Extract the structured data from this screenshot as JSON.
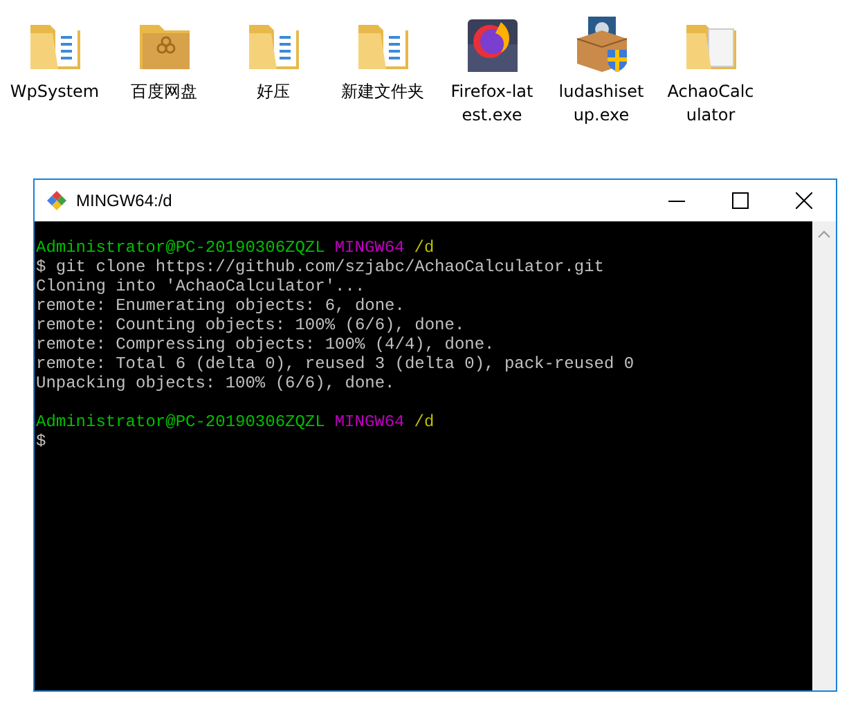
{
  "desktop_icons": [
    {
      "kind": "folder",
      "label": [
        "WpSystem"
      ],
      "selected": false
    },
    {
      "kind": "baidu-folder",
      "label": [
        "百度网盘"
      ],
      "selected": false
    },
    {
      "kind": "folder",
      "label": [
        "好压"
      ],
      "selected": false
    },
    {
      "kind": "folder",
      "label": [
        "新建文件夹"
      ],
      "selected": false
    },
    {
      "kind": "firefox",
      "label": [
        "Firefox-lat",
        "est.exe"
      ],
      "selected": false
    },
    {
      "kind": "installer",
      "label": [
        "ludashiset",
        "up.exe"
      ],
      "selected": false
    },
    {
      "kind": "empty-folder",
      "label": [
        "AchaoCalc",
        "ulator"
      ],
      "selected": false
    }
  ],
  "window": {
    "title": "MINGW64:/d",
    "controls": [
      {
        "kind": "minimize"
      },
      {
        "kind": "maximize"
      },
      {
        "kind": "close"
      }
    ]
  },
  "terminal": {
    "lines": [
      {
        "kind": "prompt",
        "segments": [
          {
            "text": "Administrator@PC-20190306ZQZL",
            "color": "#00bf00"
          },
          {
            "text": "MINGW64",
            "color": "#bf00bf"
          },
          {
            "text": "/d",
            "color": "#bfbf00"
          }
        ]
      },
      {
        "kind": "output",
        "segments": [
          {
            "text": "$ git clone https://github.com/szjabc/AchaoCalculator.git",
            "color": "#c0c0c0"
          }
        ]
      },
      {
        "kind": "output",
        "segments": [
          {
            "text": "Cloning into 'AchaoCalculator'...",
            "color": "#c0c0c0"
          }
        ]
      },
      {
        "kind": "output",
        "segments": [
          {
            "text": "remote: Enumerating objects: 6, done.",
            "color": "#c0c0c0"
          }
        ]
      },
      {
        "kind": "output",
        "segments": [
          {
            "text": "remote: Counting objects: 100% (6/6), done.",
            "color": "#c0c0c0"
          }
        ]
      },
      {
        "kind": "output",
        "segments": [
          {
            "text": "remote: Compressing objects: 100% (4/4), done.",
            "color": "#c0c0c0"
          }
        ]
      },
      {
        "kind": "output",
        "segments": [
          {
            "text": "remote: Total 6 (delta 0), reused 3 (delta 0), pack-reused 0",
            "color": "#c0c0c0"
          }
        ]
      },
      {
        "kind": "output",
        "segments": [
          {
            "text": "Unpacking objects: 100% (6/6), done.",
            "color": "#c0c0c0"
          }
        ]
      },
      {
        "kind": "blank"
      },
      {
        "kind": "prompt",
        "segments": [
          {
            "text": "Administrator@PC-20190306ZQZL",
            "color": "#00bf00"
          },
          {
            "text": "MINGW64",
            "color": "#bf00bf"
          },
          {
            "text": "/d",
            "color": "#bfbf00"
          }
        ]
      },
      {
        "kind": "output",
        "segments": [
          {
            "text": "$",
            "color": "#c0c0c0"
          }
        ]
      }
    ]
  }
}
